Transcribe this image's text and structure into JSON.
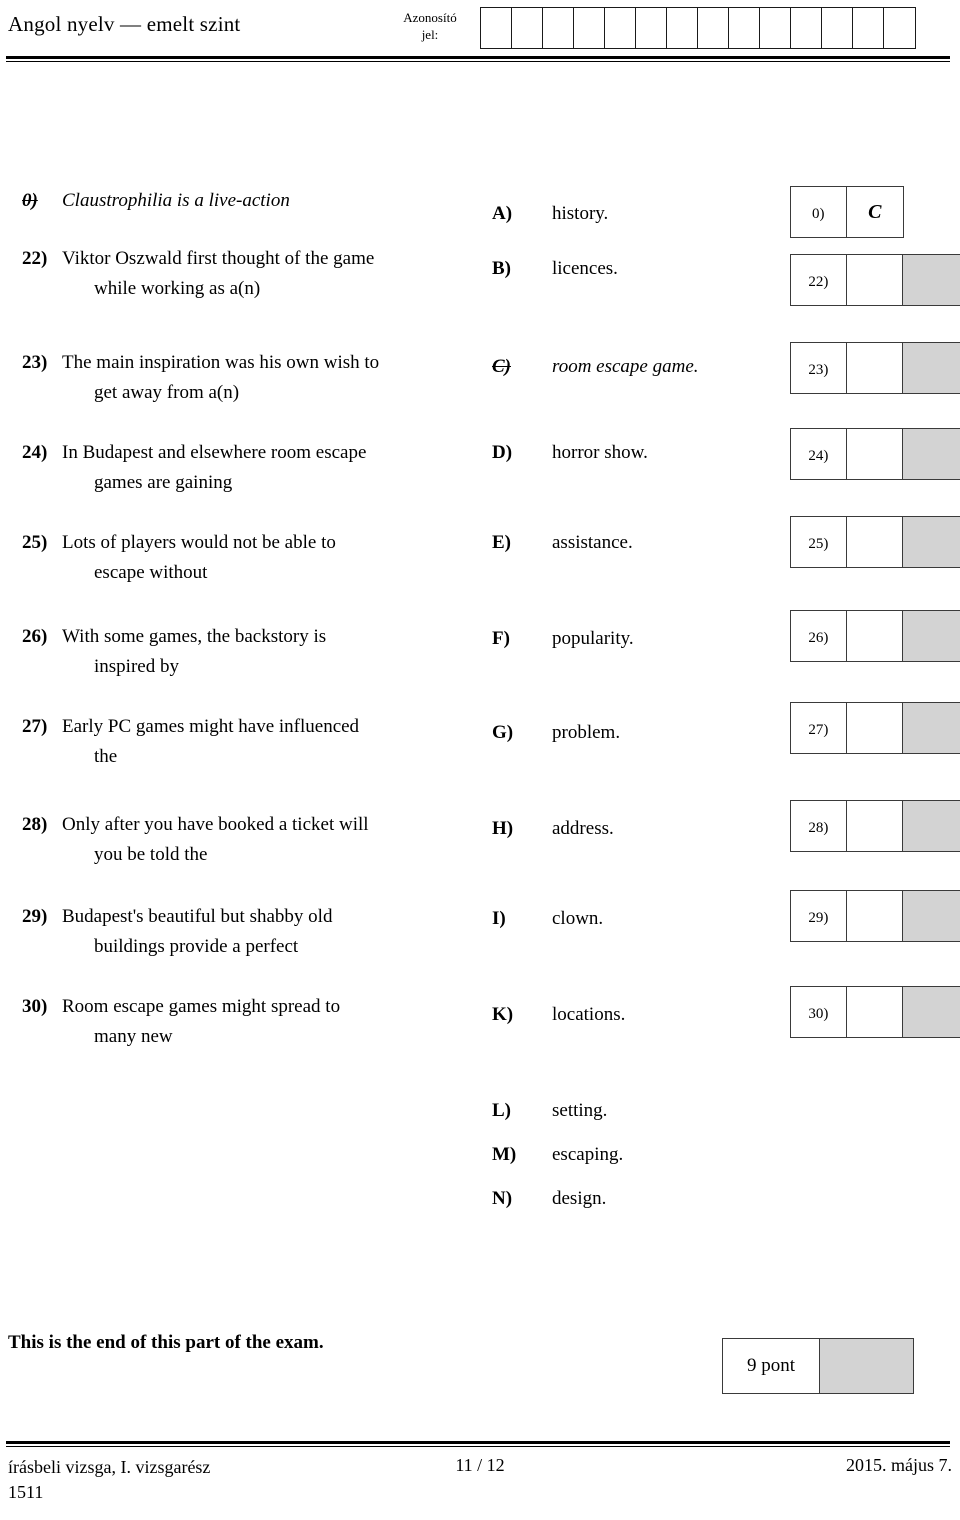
{
  "header": {
    "exam_title": "Angol nyelv — emelt szint",
    "id_label_line1": "Azonosító",
    "id_label_line2": "jel:",
    "id_cell_count": 14
  },
  "stems": [
    {
      "number": "0)",
      "line1": "Claustrophilia is a live-action",
      "line2": "",
      "example": true
    },
    {
      "number": "22)",
      "line1": "Viktor Oszwald first thought of the game",
      "line2": "while working as a(n)",
      "example": false
    },
    {
      "number": "23)",
      "line1": "The main inspiration was his own wish to",
      "line2": "get away from a(n)",
      "example": false
    },
    {
      "number": "24)",
      "line1": "In Budapest and elsewhere room escape",
      "line2": "games are gaining",
      "example": false
    },
    {
      "number": "25)",
      "line1": "Lots of players would not be able to",
      "line2": "escape without",
      "example": false
    },
    {
      "number": "26)",
      "line1": "With some games, the backstory is",
      "line2": "inspired by",
      "example": false
    },
    {
      "number": "27)",
      "line1": "Early PC games might have influenced",
      "line2": "the",
      "example": false
    },
    {
      "number": "28)",
      "line1": "Only after you have booked a ticket will",
      "line2": "you be told the",
      "example": false
    },
    {
      "number": "29)",
      "line1": "Budapest's beautiful but shabby old",
      "line2": "buildings provide a perfect",
      "example": false
    },
    {
      "number": "30)",
      "line1": "Room escape games might spread to",
      "line2": "many new",
      "example": false
    }
  ],
  "options": [
    {
      "letter": "A)",
      "text": "history.",
      "used": false
    },
    {
      "letter": "B)",
      "text": "licences.",
      "used": false
    },
    {
      "letter": "C)",
      "text": "room escape game.",
      "used": true
    },
    {
      "letter": "D)",
      "text": "horror show.",
      "used": false
    },
    {
      "letter": "E)",
      "text": "assistance.",
      "used": false
    },
    {
      "letter": "F)",
      "text": "popularity.",
      "used": false
    },
    {
      "letter": "G)",
      "text": "problem.",
      "used": false
    },
    {
      "letter": "H)",
      "text": "address.",
      "used": false
    },
    {
      "letter": "I)",
      "text": "clown.",
      "used": false
    },
    {
      "letter": "K)",
      "text": "locations.",
      "used": false
    },
    {
      "letter": "L)",
      "text": "setting.",
      "used": false
    },
    {
      "letter": "M)",
      "text": "escaping.",
      "used": false
    },
    {
      "letter": "N)",
      "text": "design.",
      "used": false
    }
  ],
  "answers": [
    {
      "number": "0)",
      "value": "C",
      "example": true
    },
    {
      "number": "22)",
      "value": "",
      "example": false
    },
    {
      "number": "23)",
      "value": "",
      "example": false
    },
    {
      "number": "24)",
      "value": "",
      "example": false
    },
    {
      "number": "25)",
      "value": "",
      "example": false
    },
    {
      "number": "26)",
      "value": "",
      "example": false
    },
    {
      "number": "27)",
      "value": "",
      "example": false
    },
    {
      "number": "28)",
      "value": "",
      "example": false
    },
    {
      "number": "29)",
      "value": "",
      "example": false
    },
    {
      "number": "30)",
      "value": "",
      "example": false
    }
  ],
  "end_note": "This is the end of this part of the exam.",
  "points": {
    "label": "9 pont"
  },
  "footer": {
    "left_line1": "írásbeli vizsga, I. vizsgarész",
    "left_line2": "1511",
    "center": "11 / 12",
    "right": "2015. május 7."
  },
  "colors": {
    "grey_cell": "#d3d3d3",
    "border": "#3a3a3a",
    "text": "#000000"
  }
}
